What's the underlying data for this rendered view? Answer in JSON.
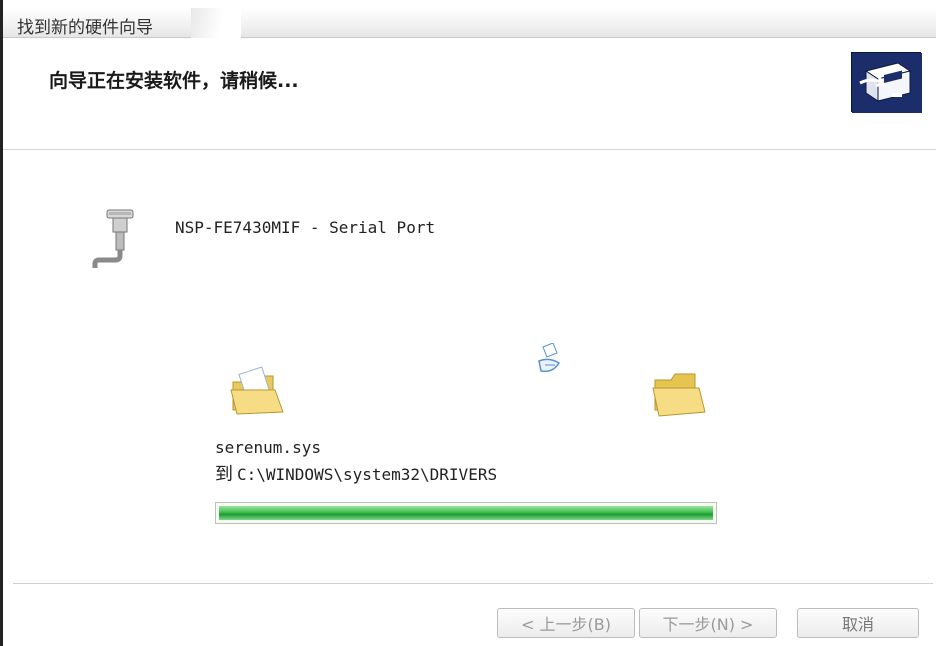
{
  "window": {
    "title": "找到新的硬件向导"
  },
  "header": {
    "heading": "向导正在安装软件，请稍候..."
  },
  "device": {
    "name": "NSP-FE7430MIF - Serial Port"
  },
  "copy": {
    "file": "serenum.sys",
    "dest_prefix": "到",
    "dest_path": "C:\\WINDOWS\\system32\\DRIVERS",
    "progress_percent": 100
  },
  "buttons": {
    "back": "< 上一步(B)",
    "next": "下一步(N) >",
    "cancel": "取消"
  },
  "colors": {
    "accent": "#2fae44",
    "wizard_icon_bg": "#1c2d6b"
  },
  "icons": {
    "wizard": "hardware-wizard-icon",
    "device": "serial-port-icon",
    "source": "open-folder-icon",
    "flying": "file-icon",
    "destination": "folder-icon"
  }
}
